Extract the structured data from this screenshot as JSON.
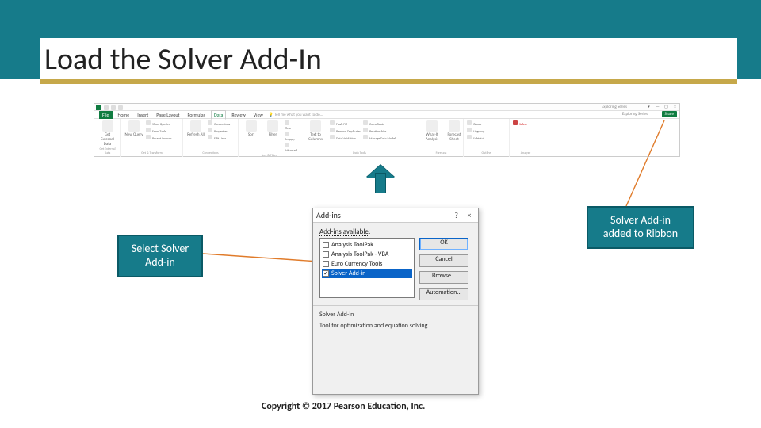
{
  "slide": {
    "title": "Load the Solver Add-In",
    "copyright": "Copyright © 2017 Pearson Education, Inc."
  },
  "callouts": {
    "left_line1": "Select Solver",
    "left_line2": "Add-in",
    "right_line1": "Solver Add-in",
    "right_line2": "added to Ribbon"
  },
  "ribbon": {
    "workbook_title": "Exploring Series",
    "share_label": "Share",
    "tell_me": "Tell me what you want to do...",
    "file_tab": "File",
    "tabs": [
      "Home",
      "Insert",
      "Page Layout",
      "Formulas",
      "Data",
      "Review",
      "View"
    ],
    "active_tab_index": 4,
    "groups": {
      "get_external": {
        "big_label": "Get External Data",
        "name": "Get External Data"
      },
      "get_transform": {
        "big_label": "New Query",
        "items": [
          "Show Queries",
          "From Table",
          "Recent Sources"
        ],
        "name": "Get & Transform"
      },
      "connections": {
        "big_label": "Refresh All",
        "items": [
          "Connections",
          "Properties",
          "Edit Links"
        ],
        "name": "Connections"
      },
      "sort_filter": {
        "sort": "Sort",
        "filter": "Filter",
        "items": [
          "Clear",
          "Reapply",
          "Advanced"
        ],
        "name": "Sort & Filter"
      },
      "data_tools": {
        "big_label": "Text to Columns",
        "items": [
          "Flash Fill",
          "Remove Duplicates",
          "Data Validation"
        ],
        "right_items": [
          "Consolidate",
          "Relationships",
          "Manage Data Model"
        ],
        "name": "Data Tools"
      },
      "forecast": {
        "labels": [
          "What-If Analysis",
          "Forecast Sheet"
        ],
        "name": "Forecast"
      },
      "outline": {
        "items": [
          "Group",
          "Ungroup",
          "Subtotal"
        ],
        "name": "Outline"
      },
      "analyze": {
        "solver_label": "Solver",
        "name": "Analyze"
      }
    }
  },
  "dialog": {
    "title": "Add-ins",
    "help_glyph": "?",
    "close_glyph": "×",
    "available_label": "Add-ins available:",
    "items": [
      {
        "label": "Analysis ToolPak",
        "checked": false,
        "selected": false
      },
      {
        "label": "Analysis ToolPak - VBA",
        "checked": false,
        "selected": false
      },
      {
        "label": "Euro Currency Tools",
        "checked": false,
        "selected": false
      },
      {
        "label": "Solver Add-in",
        "checked": true,
        "selected": true
      }
    ],
    "buttons": {
      "ok": "OK",
      "cancel": "Cancel",
      "browse": "Browse...",
      "automation": "Automation..."
    },
    "desc_head": "Solver Add-in",
    "desc_body": "Tool for optimization and equation solving"
  }
}
